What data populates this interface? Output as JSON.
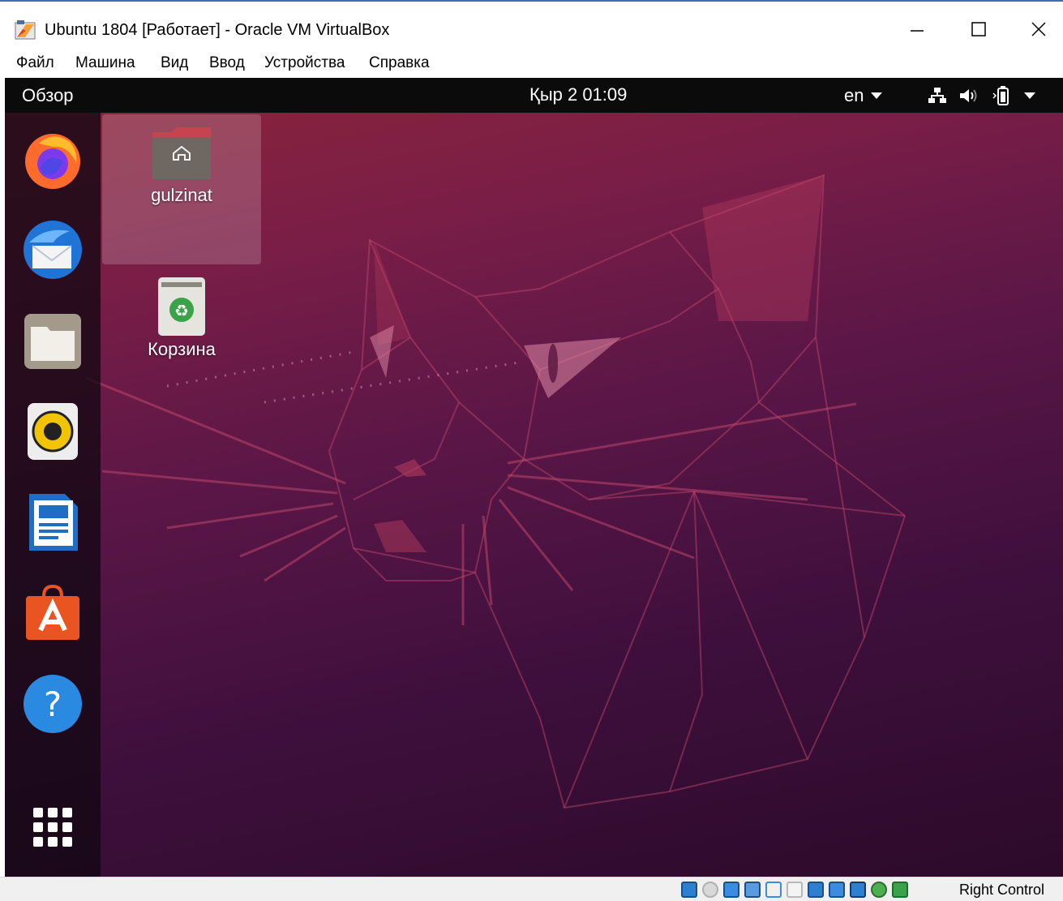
{
  "window": {
    "title": "Ubuntu 1804 [Работает] - Oracle VM VirtualBox",
    "app_icon": "virtualbox-icon",
    "controls": [
      "minimize-icon",
      "maximize-icon",
      "close-icon"
    ]
  },
  "menu": {
    "items": [
      "Файл",
      "Машина",
      "Вид",
      "Ввод",
      "Устройства",
      "Справка"
    ]
  },
  "topbar": {
    "activities": "Обзор",
    "clock": "Қыр 2  01:09",
    "language": "en",
    "tray_icons": [
      "network-icon",
      "volume-icon",
      "battery-icon",
      "system-menu-chevron-icon"
    ]
  },
  "dock": {
    "items": [
      {
        "name": "firefox",
        "icon": "firefox-icon"
      },
      {
        "name": "thunderbird",
        "icon": "thunderbird-icon"
      },
      {
        "name": "files",
        "icon": "files-icon"
      },
      {
        "name": "rhythmbox",
        "icon": "rhythmbox-icon"
      },
      {
        "name": "libreoffice-writer",
        "icon": "writer-icon"
      },
      {
        "name": "ubuntu-software",
        "icon": "software-icon"
      },
      {
        "name": "help",
        "icon": "help-icon"
      },
      {
        "name": "show-applications",
        "icon": "app-grid-icon"
      }
    ]
  },
  "desktop": {
    "icons": [
      {
        "label": "gulzinat",
        "icon": "home-folder-icon",
        "selected": true
      },
      {
        "label": "Корзина",
        "icon": "trash-icon",
        "selected": false
      }
    ]
  },
  "statusbar": {
    "icons": [
      "hard-disk-icon",
      "optical-drive-icon",
      "audio-icon",
      "network-adapter-icon",
      "usb-icon",
      "shared-folder-icon",
      "display-icon",
      "video-capture-icon",
      "cpu-icon",
      "mouse-integration-icon",
      "host-key-icon"
    ],
    "host_key": "Right Control"
  },
  "colors": {
    "titlebar_border": "#3c6fb5",
    "topbar": "#0b0b0b",
    "dock": "#1a0b1a",
    "wallpaper_top": "#8d2438",
    "wallpaper_bottom": "#2c0a2a"
  }
}
